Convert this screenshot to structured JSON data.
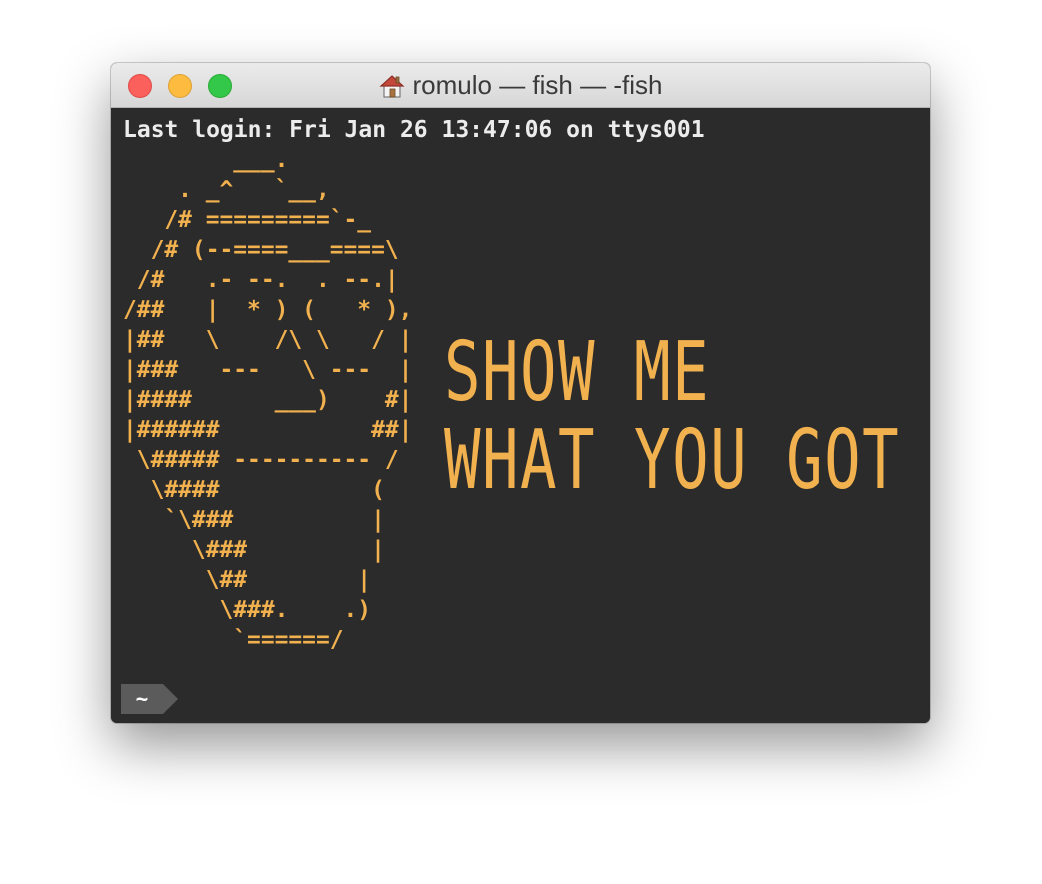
{
  "window": {
    "title": "romulo — fish — -fish",
    "title_icon": "home-icon",
    "buttons": {
      "close": "close-button",
      "minimize": "minimize-button",
      "zoom": "zoom-button"
    }
  },
  "terminal": {
    "last_login": "Last login: Fri Jan 26 13:47:06 on ttys001",
    "ascii_art": "        ___.\n    . _^   `__,\n   /# =========`-_\n  /# (--====___====\\\n /#   .- --.  . --.|\n/##   |  * ) (   * ),\n|##   \\    /\\ \\   / |\n|###   ---   \\ ---  |\n|####      ___)    #|\n|######           ##|\n \\##### ---------- /\n  \\####           (\n   `\\###          |\n     \\###         |\n      \\##        |\n       \\###.    .)\n        `======/",
    "big_text_line1": "SHOW ME",
    "big_text_line2": "WHAT YOU GOT",
    "prompt": "~"
  },
  "colors": {
    "terminal_bg": "#2b2b2b",
    "ascii_color": "#f2b14f",
    "text_color": "#ececec",
    "close": "#fc605c",
    "minimize": "#fdbc40",
    "zoom": "#34c84a"
  }
}
